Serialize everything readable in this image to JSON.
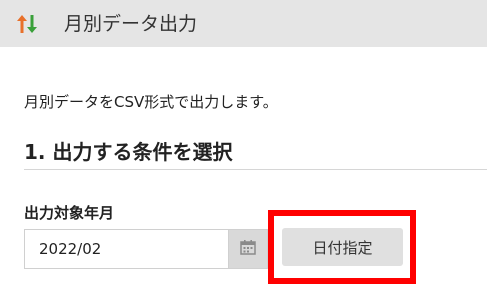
{
  "header": {
    "icon": "sort-up-down-icon",
    "title": "月別データ出力"
  },
  "main": {
    "description": "月別データをCSV形式で出力します。",
    "section_title": "1. 出力する条件を選択",
    "field_label": "出力対象年月",
    "date_value": "2022/02",
    "calendar_icon": "calendar-icon",
    "date_button_label": "日付指定"
  },
  "colors": {
    "header_bg": "#e5e5e5",
    "arrow_up": "#e8702a",
    "arrow_down": "#3aa03a",
    "highlight": "#ff0000"
  }
}
